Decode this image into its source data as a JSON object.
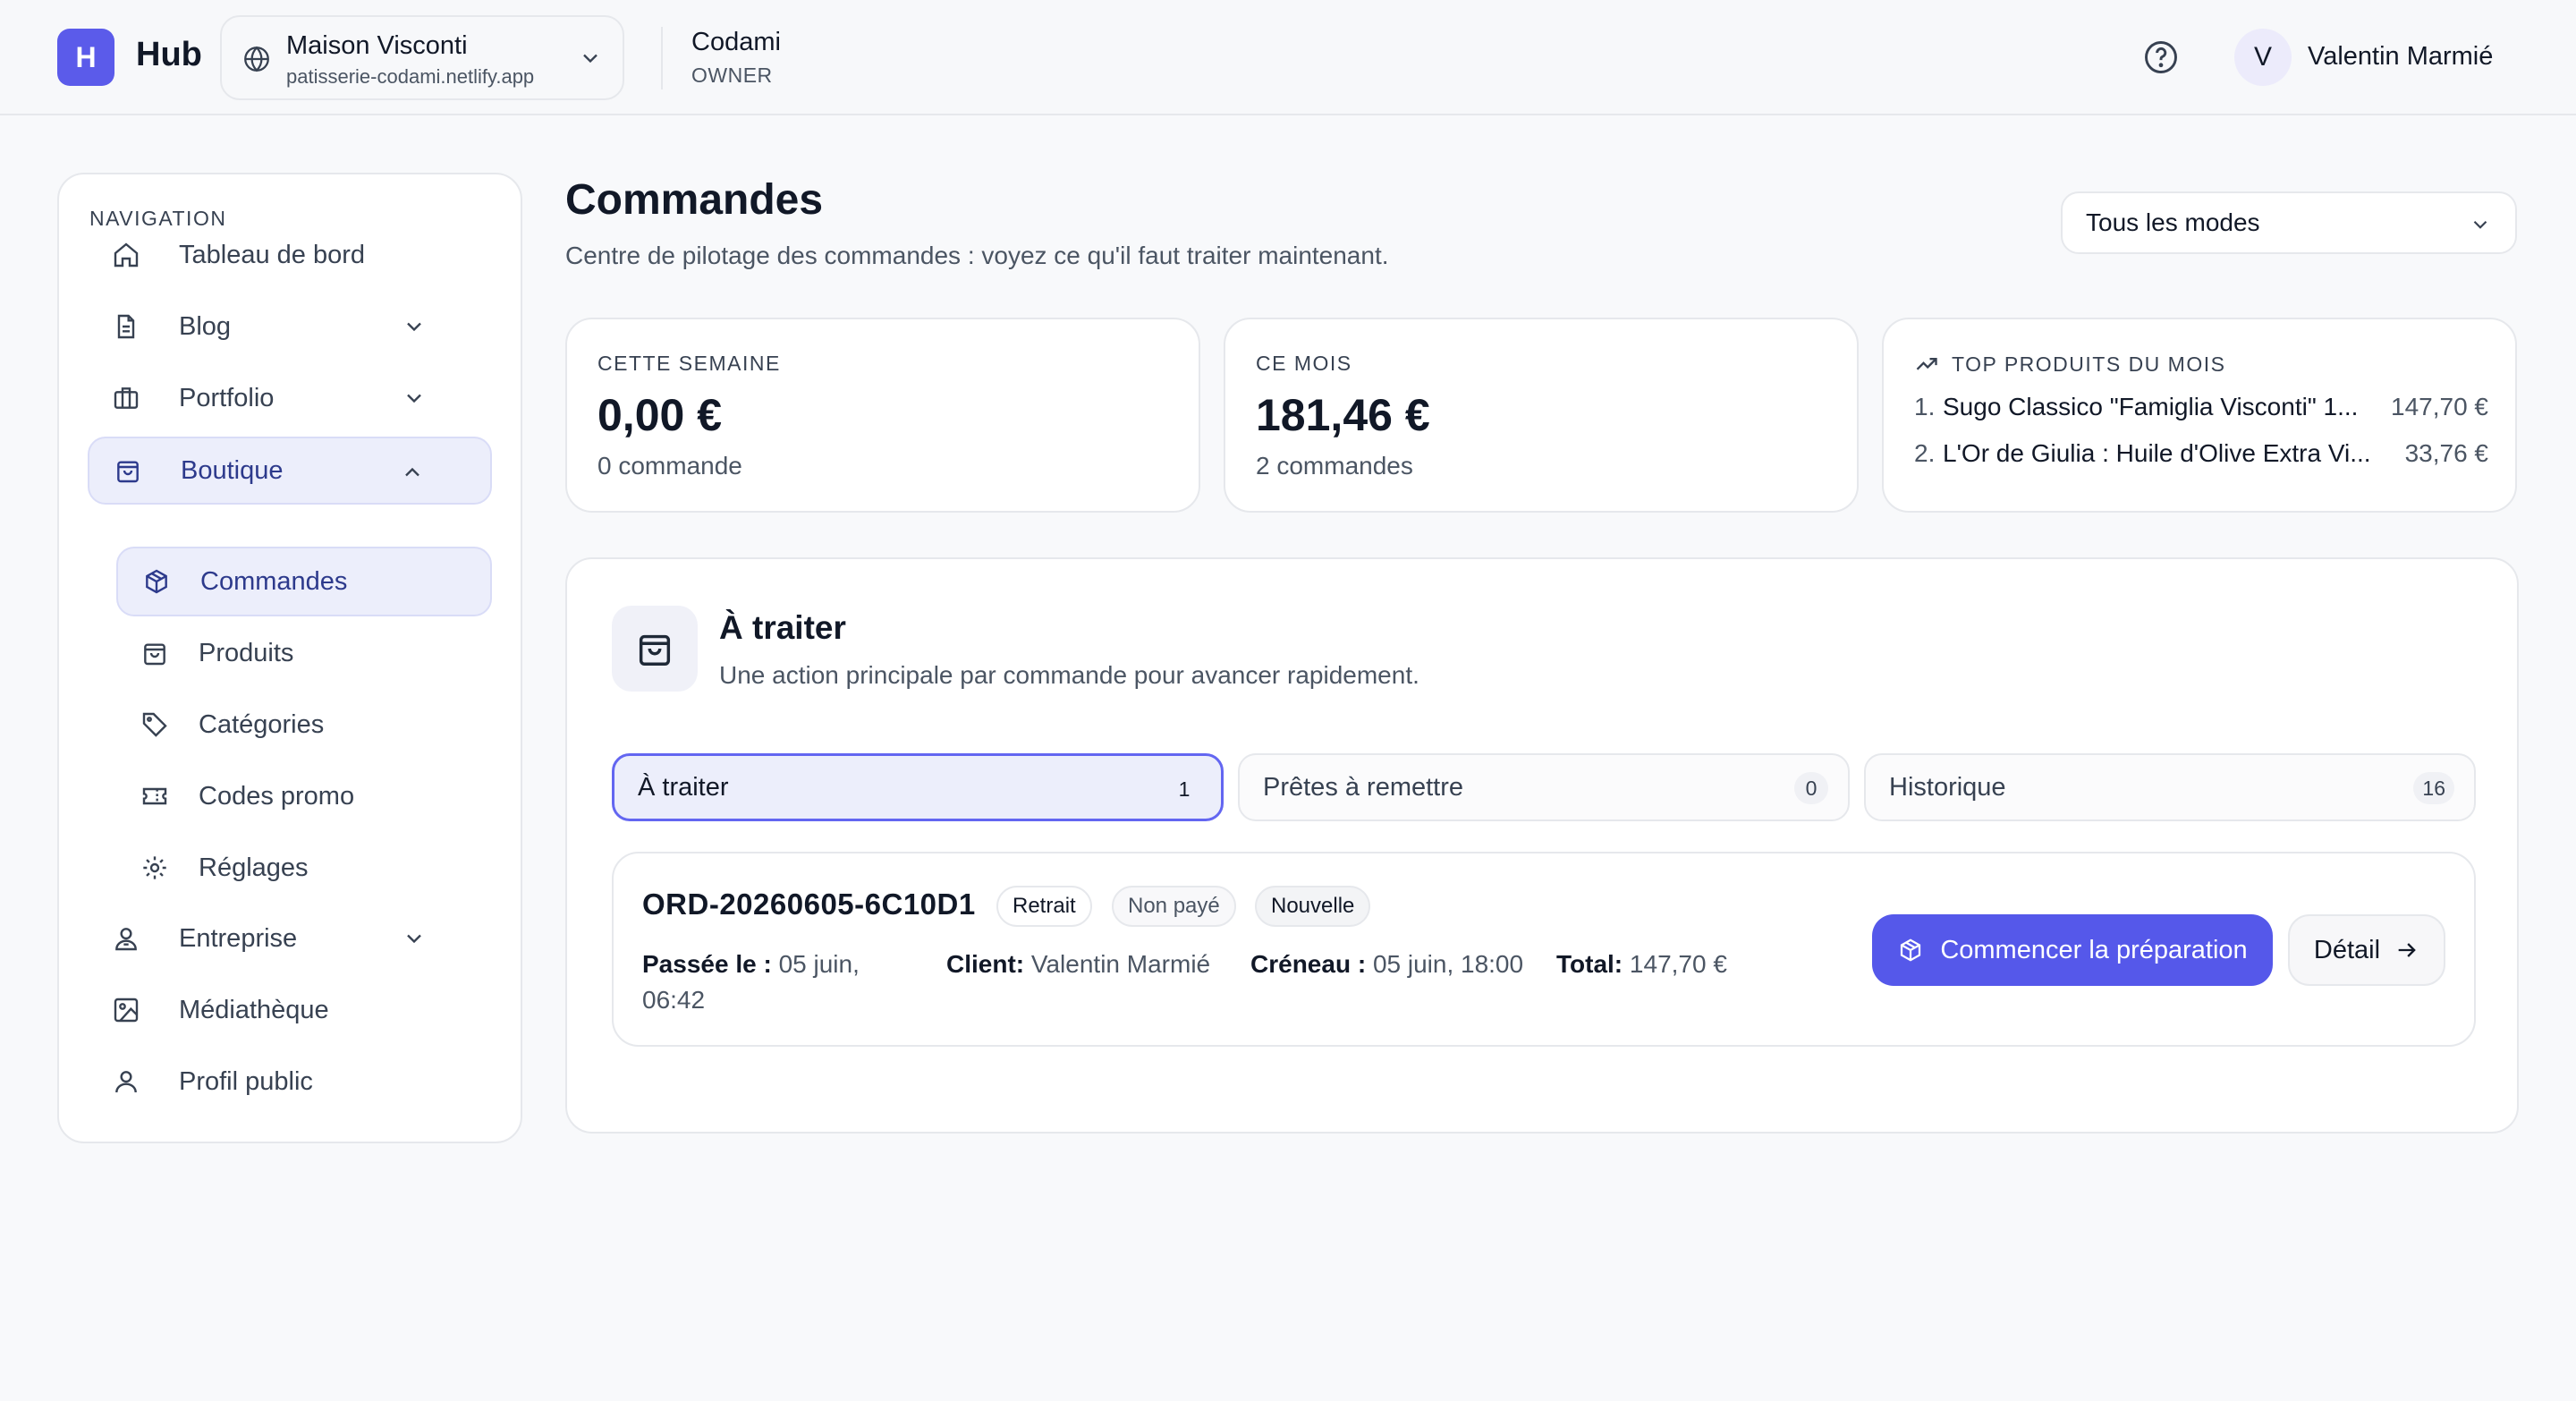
{
  "header": {
    "logo_letter": "H",
    "brand": "Hub",
    "site": {
      "name": "Maison Visconti",
      "domain": "patisserie-codami.netlify.app"
    },
    "org": {
      "name": "Codami",
      "role": "OWNER"
    },
    "user": {
      "initial": "V",
      "name": "Valentin Marmié"
    }
  },
  "sidebar": {
    "heading": "NAVIGATION",
    "items": [
      {
        "label": "Tableau de bord",
        "icon": "home-icon"
      },
      {
        "label": "Blog",
        "icon": "document-icon"
      },
      {
        "label": "Portfolio",
        "icon": "briefcase-icon"
      },
      {
        "label": "Boutique",
        "icon": "shopping-bag-icon"
      },
      {
        "label": "Entreprise",
        "icon": "user-badge-icon"
      },
      {
        "label": "Médiathèque",
        "icon": "image-icon"
      },
      {
        "label": "Profil public",
        "icon": "user-icon"
      }
    ],
    "boutique_sub": [
      {
        "label": "Commandes",
        "icon": "cube-icon"
      },
      {
        "label": "Produits",
        "icon": "shopping-bag-icon"
      },
      {
        "label": "Catégories",
        "icon": "tag-icon"
      },
      {
        "label": "Codes promo",
        "icon": "ticket-icon"
      },
      {
        "label": "Réglages",
        "icon": "gear-icon"
      }
    ]
  },
  "main": {
    "title": "Commandes",
    "subtitle": "Centre de pilotage des commandes : voyez ce qu'il faut traiter maintenant.",
    "mode_select": "Tous les modes",
    "stats": {
      "week": {
        "label": "CETTE SEMAINE",
        "value": "0,00 €",
        "sub": "0 commande"
      },
      "month": {
        "label": "CE MOIS",
        "value": "181,46 €",
        "sub": "2 commandes"
      },
      "top": {
        "label": "TOP PRODUITS DU MOIS",
        "items": [
          {
            "rank": "1.",
            "name": "Sugo Classico \"Famiglia Visconti\" 1...",
            "price": "147,70 €"
          },
          {
            "rank": "2.",
            "name": "L'Or de Giulia : Huile d'Olive Extra Vi...",
            "price": "33,76 €"
          }
        ]
      }
    },
    "panel": {
      "title": "À traiter",
      "subtitle": "Une action principale par commande pour avancer rapidement.",
      "tabs": [
        {
          "label": "À traiter",
          "count": "1"
        },
        {
          "label": "Prêtes à remettre",
          "count": "0"
        },
        {
          "label": "Historique",
          "count": "16"
        }
      ],
      "order": {
        "id": "ORD-20260605-6C10D1",
        "badges": [
          "Retrait",
          "Non payé",
          "Nouvelle"
        ],
        "placed_label": "Passée le :",
        "placed_value": "05 juin, 06:42",
        "client_label": "Client:",
        "client_value": "Valentin Marmié",
        "slot_label": "Créneau :",
        "slot_value": "05 juin, 18:00",
        "total_label": "Total:",
        "total_value": "147,70 €",
        "primary_action": "Commencer la préparation",
        "secondary_action": "Détail"
      }
    }
  },
  "colors": {
    "accent": "#5558ea",
    "active_bg": "#eceefb",
    "border": "#e6e8ec"
  }
}
